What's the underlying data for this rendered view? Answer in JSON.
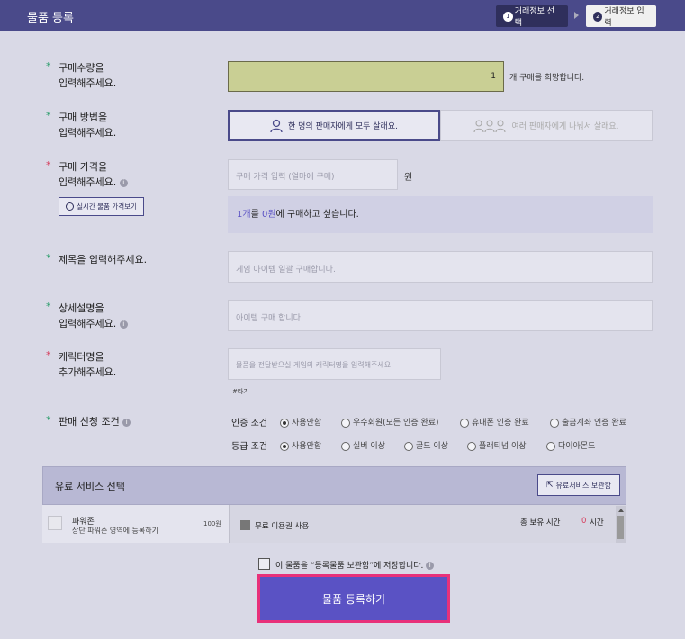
{
  "header": {
    "title": "물품 등록",
    "steps": [
      {
        "num": "1",
        "label": "거래정보 선택"
      },
      {
        "num": "2",
        "label": "거래정보 입력"
      }
    ]
  },
  "quantity": {
    "label_line1": "구매수량을",
    "label_line2": "입력해주세요.",
    "value": "1",
    "suffix": "개 구매를 희망합니다."
  },
  "method": {
    "label_line1": "구매 방법을",
    "label_line2": "입력해주세요.",
    "option_single": "한 명의 판매자에게 모두 살래요.",
    "option_multi": "여러 판매자에게 나눠서 살래요."
  },
  "price": {
    "label_line1": "구매 가격을",
    "label_line2": "입력해주세요.",
    "realtime_button": "실시간 물품 가격보기",
    "placeholder": "구매 가격 입력 (얼마에 구매)",
    "unit": "원",
    "summary_qty": "1개",
    "summary_mid": "를 ",
    "summary_price": "0원",
    "summary_end": "에 구매하고 싶습니다."
  },
  "title_field": {
    "label": "제목을 입력해주세요.",
    "placeholder": "게임 아이템 일괄 구매합니다."
  },
  "description": {
    "label_line1": "상세설명을",
    "label_line2": "입력해주세요.",
    "placeholder": "아이템 구매 합니다."
  },
  "character": {
    "label_line1": "캐릭터명을",
    "label_line2": "추가해주세요.",
    "placeholder": "물품을 전달받으실 게임의 캐릭터명을 입력해주세요.",
    "tag": "#타기"
  },
  "conditions": {
    "label": "판매 신청 조건",
    "auth_label": "인증 조건",
    "auth_options": [
      "사용안함",
      "우수회원(모든 인증 완료)",
      "휴대폰 인증 완료",
      "출금계좌 인증 완료"
    ],
    "grade_label": "등급 조건",
    "grade_options": [
      "사용안함",
      "실버 이상",
      "골드 이상",
      "플래티넘 이상",
      "다이아몬드"
    ]
  },
  "paid_service": {
    "title": "유료 서비스 선택",
    "storage_button": "유료서비스 보관함",
    "item_name": "파워존",
    "item_desc": "상단 파워존 영역에 등록하기",
    "item_price": "100원",
    "free_use": "무료 이용권 사용",
    "total_label": "총 보유 시간",
    "total_value": "0",
    "total_unit": "시간"
  },
  "save_option": {
    "label": "이 물품을 “등록물품 보관함”에 저장합니다."
  },
  "submit": {
    "label": "물품 등록하기"
  },
  "colors": {
    "header": "#4a4a8a",
    "accent": "#5a52c4",
    "highlight_border": "#e8317a",
    "required_green": "#2a9d6a",
    "required_red": "#d63a5a"
  }
}
